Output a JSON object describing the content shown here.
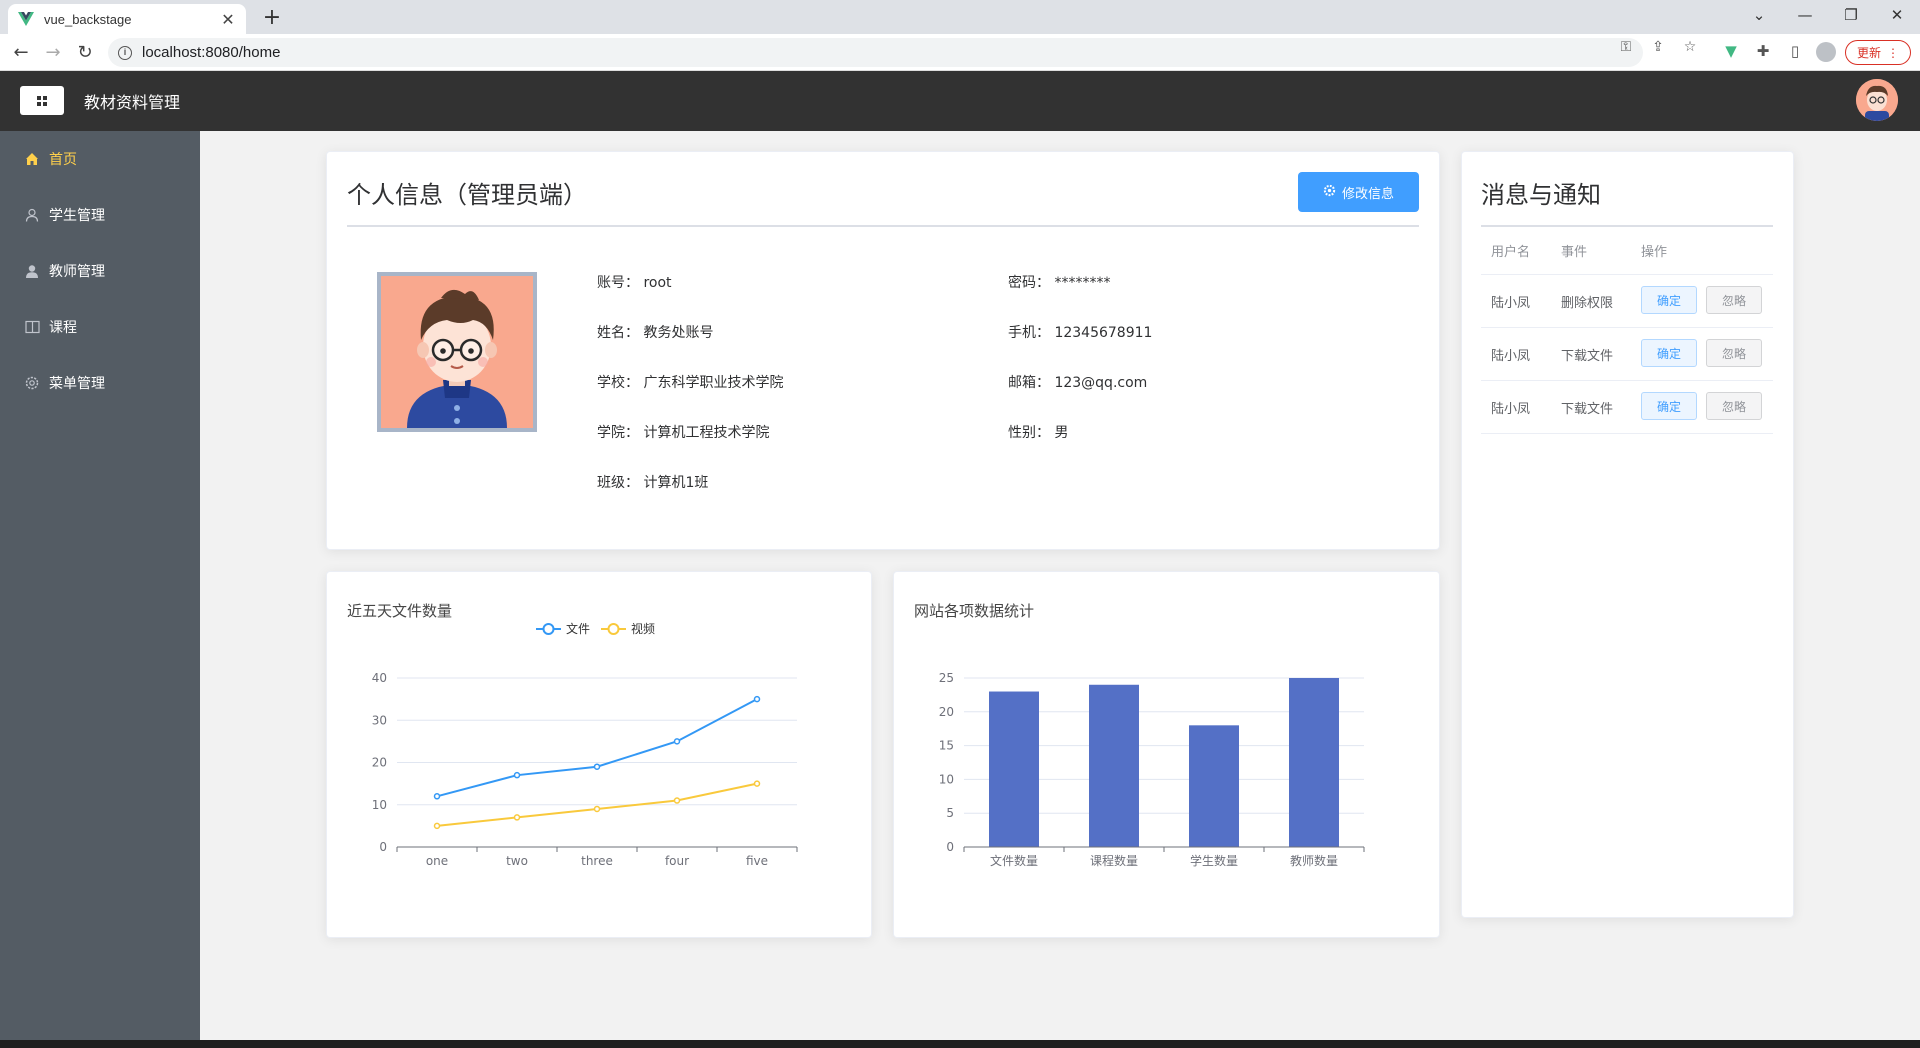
{
  "browser": {
    "tab_title": "vue_backstage",
    "url": "localhost:8080/home",
    "update_label": "更新"
  },
  "app": {
    "title": "教材资料管理"
  },
  "sidebar": {
    "items": [
      {
        "label": "首页",
        "icon": "home-icon",
        "active": true
      },
      {
        "label": "学生管理",
        "icon": "user-icon",
        "active": false
      },
      {
        "label": "教师管理",
        "icon": "user-solid-icon",
        "active": false
      },
      {
        "label": "课程",
        "icon": "book-icon",
        "active": false
      },
      {
        "label": "菜单管理",
        "icon": "gear-icon",
        "active": false
      }
    ],
    "active_color": "#ffd04b"
  },
  "profile": {
    "title": "个人信息（管理员端）",
    "edit_label": "修改信息",
    "fields": {
      "account": {
        "label": "账号：",
        "value": "root"
      },
      "password": {
        "label": "密码：",
        "value": "********"
      },
      "name": {
        "label": "姓名：",
        "value": "教务处账号"
      },
      "phone": {
        "label": "手机：",
        "value": "12345678911"
      },
      "school": {
        "label": "学校：",
        "value": "广东科学职业技术学院"
      },
      "email": {
        "label": "邮箱：",
        "value": "123@qq.com"
      },
      "college": {
        "label": "学院：",
        "value": "计算机工程技术学院"
      },
      "gender": {
        "label": "性别：",
        "value": "男"
      },
      "class": {
        "label": "班级：",
        "value": "计算机1班"
      }
    }
  },
  "notifications": {
    "title": "消息与通知",
    "headers": [
      "用户名",
      "事件",
      "操作"
    ],
    "rows": [
      {
        "user": "陆小凤",
        "event": "删除权限",
        "confirm": "确定",
        "ignore": "忽略"
      },
      {
        "user": "陆小凤",
        "event": "下载文件",
        "confirm": "确定",
        "ignore": "忽略"
      },
      {
        "user": "陆小凤",
        "event": "下载文件",
        "confirm": "确定",
        "ignore": "忽略"
      }
    ]
  },
  "chart_data": [
    {
      "type": "line",
      "title": "近五天文件数量",
      "categories": [
        "one",
        "two",
        "three",
        "four",
        "five"
      ],
      "series": [
        {
          "name": "文件",
          "values": [
            12,
            17,
            19,
            25,
            35
          ],
          "color": "#3398f5"
        },
        {
          "name": "视频",
          "values": [
            5,
            7,
            9,
            11,
            15
          ],
          "color": "#f9c93c"
        }
      ],
      "ylim": [
        0,
        40
      ],
      "yticks": [
        0,
        10,
        20,
        30,
        40
      ],
      "legend": "top-center",
      "grid": true
    },
    {
      "type": "bar",
      "title": "网站各项数据统计",
      "categories": [
        "文件数量",
        "课程数量",
        "学生数量",
        "教师数量"
      ],
      "values": [
        23,
        24,
        18,
        25
      ],
      "color": "#5470c6",
      "ylim": [
        0,
        25
      ],
      "yticks": [
        0,
        5,
        10,
        15,
        20,
        25
      ],
      "grid": true
    }
  ]
}
